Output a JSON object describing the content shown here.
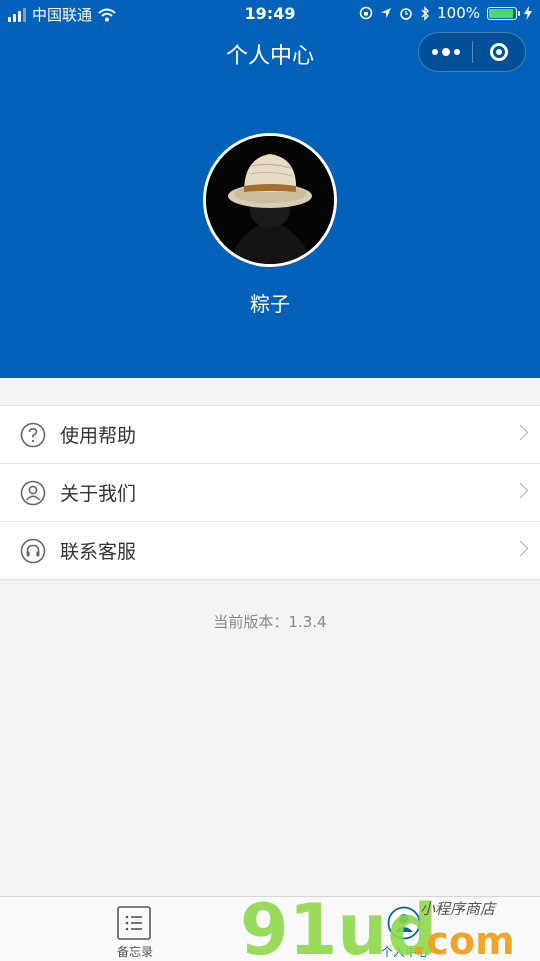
{
  "status_bar": {
    "carrier": "中国联通",
    "time": "19:49",
    "battery": "100%"
  },
  "nav": {
    "title": "个人中心"
  },
  "profile": {
    "username": "粽子"
  },
  "menu": {
    "items": [
      {
        "label": "使用帮助",
        "icon": "question-circle-icon"
      },
      {
        "label": "关于我们",
        "icon": "user-circle-icon"
      },
      {
        "label": "联系客服",
        "icon": "headset-icon"
      }
    ]
  },
  "version_text": "当前版本：1.3.4",
  "tabbar": {
    "tabs": [
      {
        "label": "备忘录",
        "icon": "list-icon",
        "active": false
      },
      {
        "label": "个人中心",
        "icon": "user-icon",
        "active": true
      }
    ]
  },
  "watermark": {
    "text": "91ud.com",
    "subtext": "小程序商店"
  },
  "colors": {
    "brand": "#0262b9",
    "background": "#f4f4f4",
    "watermark_green": "#8fd94a",
    "watermark_orange": "#f0a11f"
  }
}
